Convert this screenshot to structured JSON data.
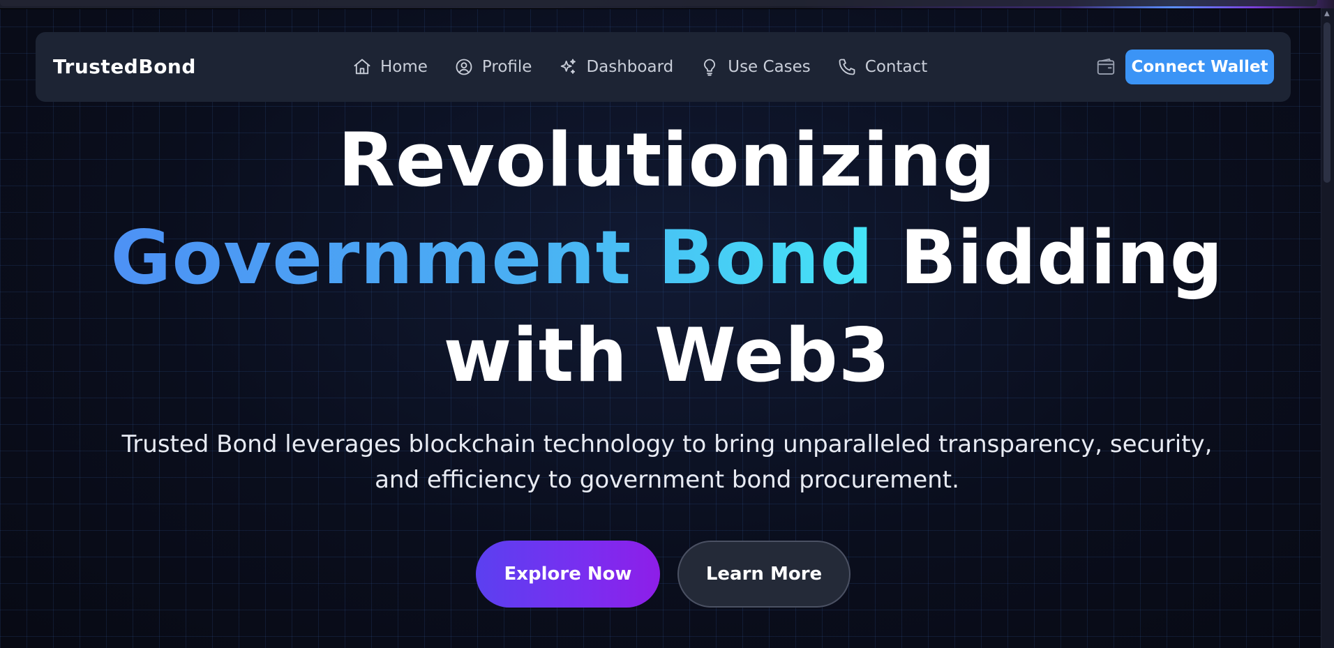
{
  "brand": "TrustedBond",
  "nav": {
    "items": [
      {
        "label": "Home",
        "icon": "home-icon"
      },
      {
        "label": "Profile",
        "icon": "user-circle-icon"
      },
      {
        "label": "Dashboard",
        "icon": "sparkles-icon"
      },
      {
        "label": "Use Cases",
        "icon": "lightbulb-icon"
      },
      {
        "label": "Contact",
        "icon": "phone-icon"
      }
    ],
    "wallet_icon": "wallet-icon",
    "connect_label": "Connect Wallet"
  },
  "hero": {
    "line1": "Revolutionizing",
    "highlight": "Government Bond",
    "line2_rest": "Bidding",
    "line3": "with Web3",
    "subtitle_line1": "Trusted Bond leverages blockchain technology to bring unparalleled transparency, security,",
    "subtitle_line2": "and efficiency to government bond procurement.",
    "explore_label": "Explore Now",
    "learn_label": "Learn More"
  },
  "colors": {
    "accent_blue": "#3b94f6",
    "gradient_start": "#4d91f5",
    "gradient_end": "#45e5f7",
    "explore_start": "#5b40f0",
    "explore_end": "#8e1ee8",
    "nav_bg": "#1d2434"
  }
}
